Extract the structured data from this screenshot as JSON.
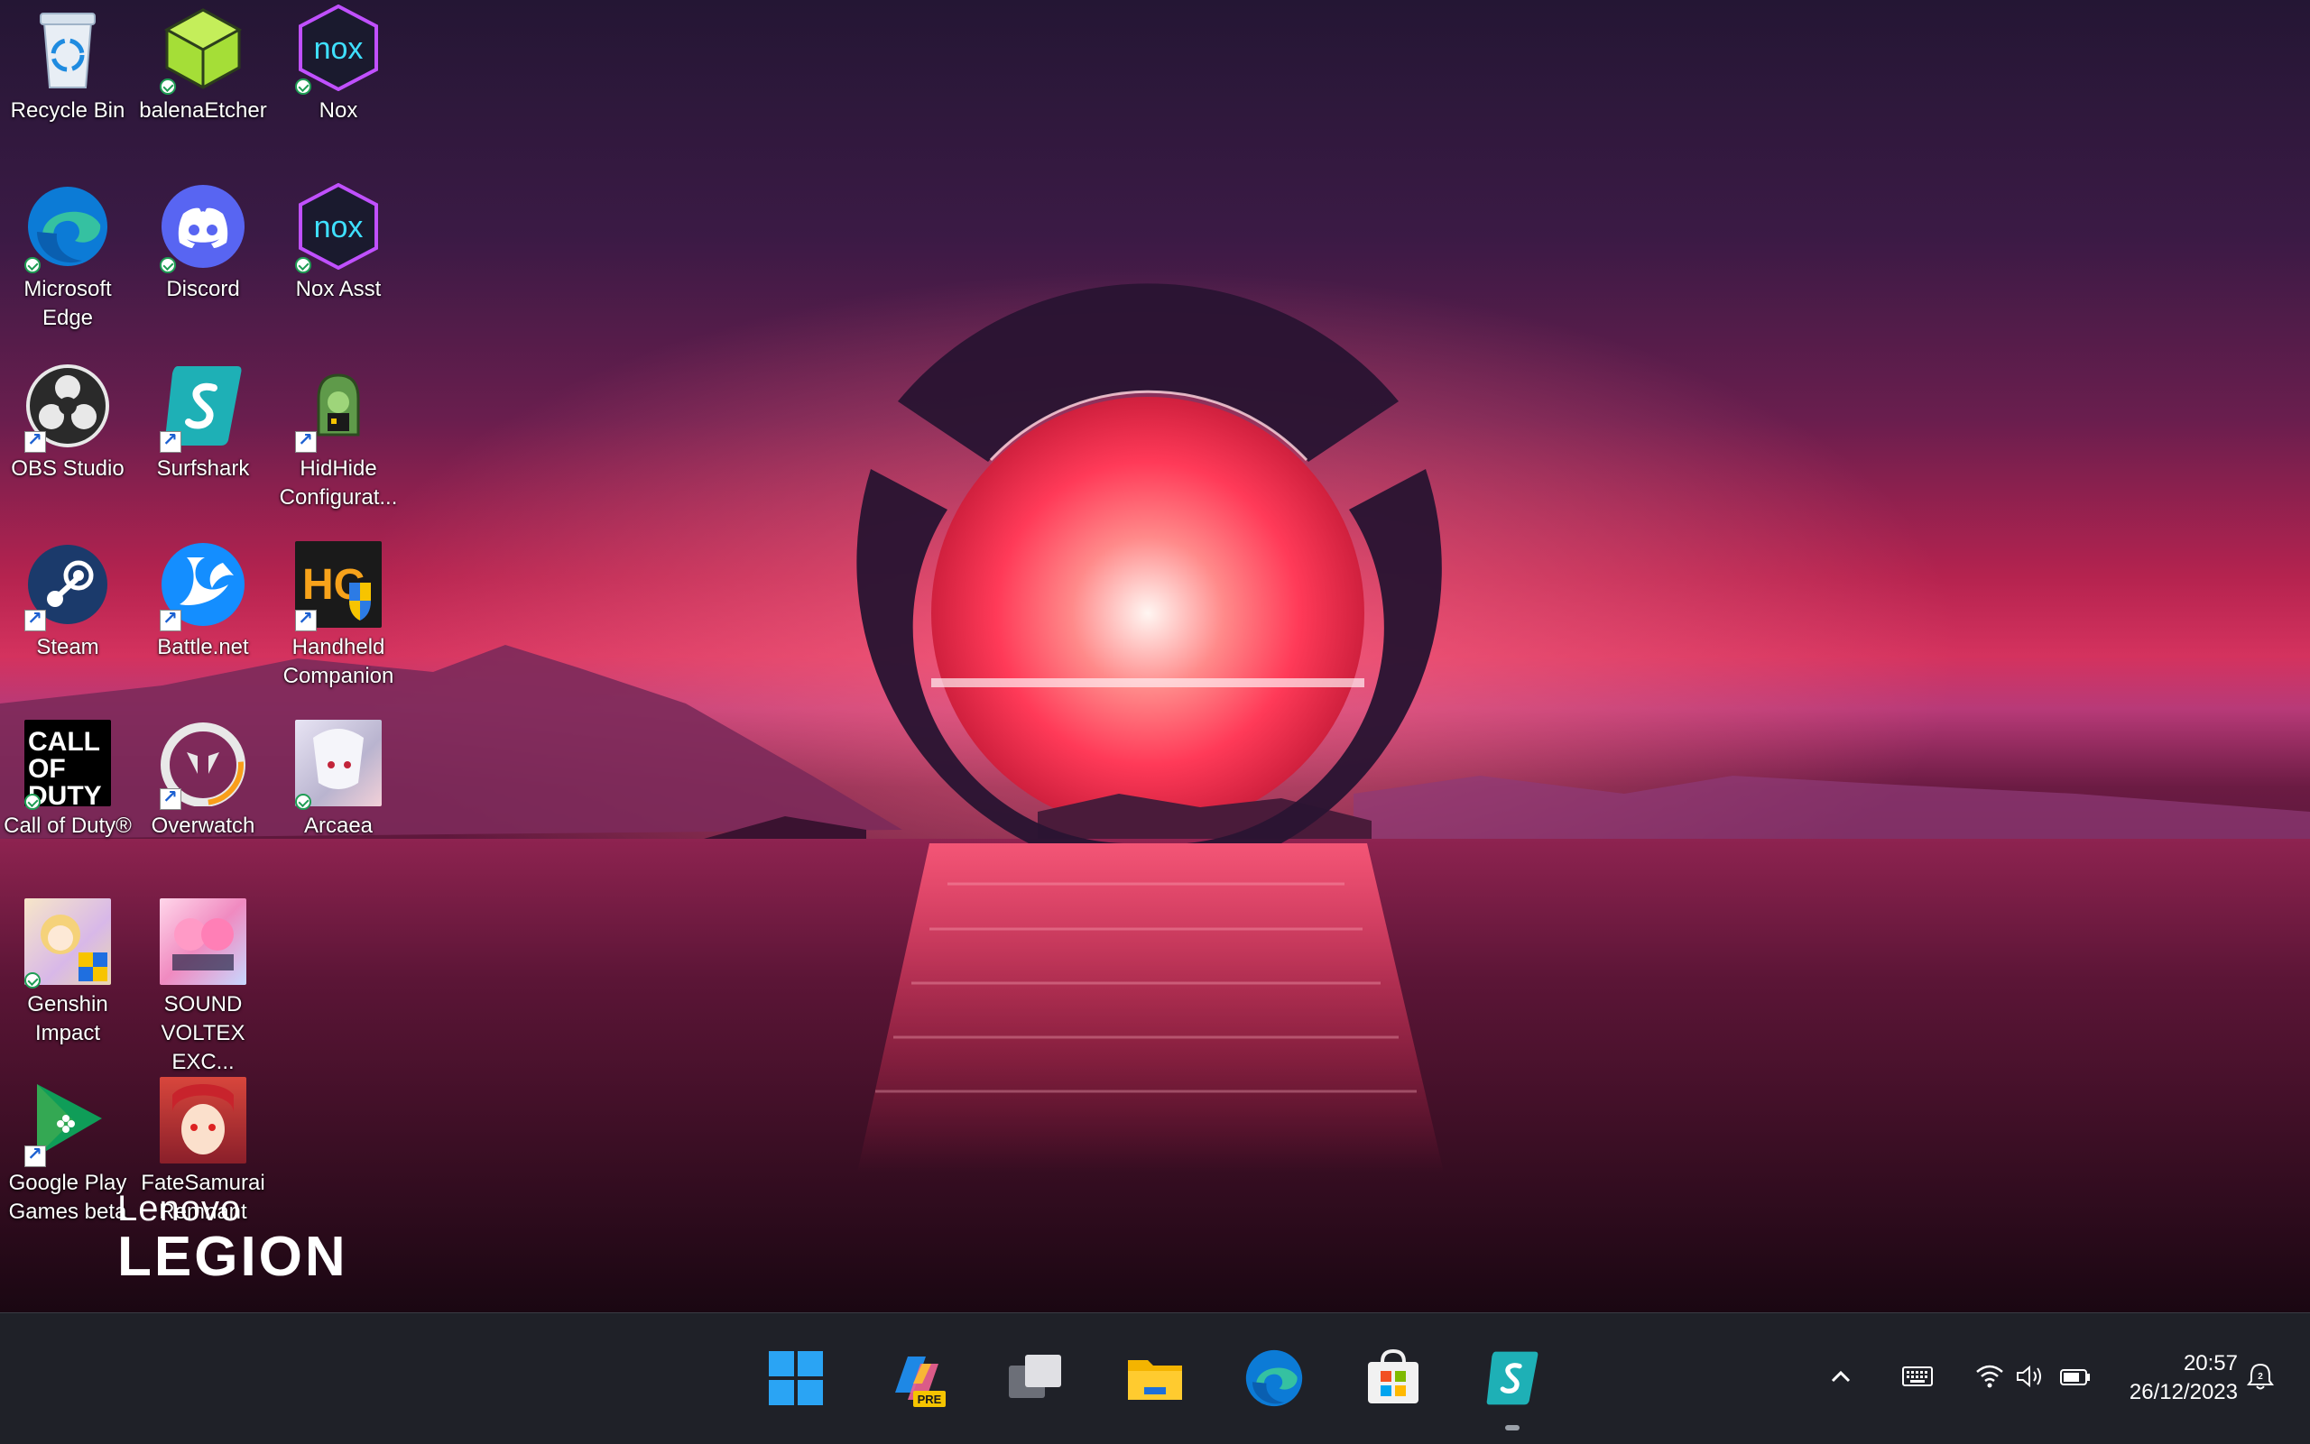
{
  "desktop": {
    "icons": [
      {
        "label": "Recycle Bin",
        "icon": "recycle-bin-icon"
      },
      {
        "label": "balenaEtcher",
        "icon": "balena-etcher-icon"
      },
      {
        "label": "Nox",
        "icon": "nox-icon"
      },
      {
        "label": "Microsoft Edge",
        "icon": "edge-icon"
      },
      {
        "label": "Discord",
        "icon": "discord-icon"
      },
      {
        "label": "Nox Asst",
        "icon": "nox-asst-icon"
      },
      {
        "label": "OBS Studio",
        "icon": "obs-icon"
      },
      {
        "label": "Surfshark",
        "icon": "surfshark-icon"
      },
      {
        "label": "HidHide Configurat...",
        "icon": "hidhide-icon"
      },
      {
        "label": "Steam",
        "icon": "steam-icon"
      },
      {
        "label": "Battle.net",
        "icon": "battlenet-icon"
      },
      {
        "label": "Handheld Companion",
        "icon": "handheld-companion-icon"
      },
      {
        "label": "Call of Duty®",
        "icon": "call-of-duty-icon",
        "art_text": "CALL OF DUTY"
      },
      {
        "label": "Overwatch",
        "icon": "overwatch-icon"
      },
      {
        "label": "Arcaea",
        "icon": "arcaea-icon"
      },
      {
        "label": "Genshin Impact",
        "icon": "genshin-icon"
      },
      {
        "label": "SOUND VOLTEX EXC...",
        "icon": "sound-voltex-icon"
      },
      {
        "label": "Google Play Games beta",
        "icon": "google-play-games-icon"
      },
      {
        "label": "FateSamurai Remnant",
        "icon": "fate-samurai-icon"
      }
    ],
    "brand": {
      "line1": "Lenovo",
      "line2": "LEGION"
    },
    "nox_logo_text": "nox",
    "handheld_logo_text": "HC"
  },
  "taskbar": {
    "apps": [
      {
        "name": "start-button",
        "icon": "windows-icon"
      },
      {
        "name": "copilot-button",
        "icon": "copilot-icon",
        "badge": "PRE"
      },
      {
        "name": "task-view-button",
        "icon": "task-view-icon"
      },
      {
        "name": "file-explorer-button",
        "icon": "folder-icon"
      },
      {
        "name": "edge-taskbar-button",
        "icon": "edge-icon"
      },
      {
        "name": "store-button",
        "icon": "store-icon"
      },
      {
        "name": "surfshark-taskbar-button",
        "icon": "surfshark-icon",
        "active": true
      }
    ],
    "tray": {
      "overflow": "chevron-up-icon",
      "keyboard": "keyboard-icon",
      "wifi": "wifi-icon",
      "volume": "volume-icon",
      "battery": "battery-icon",
      "notification": "notification-bell-icon",
      "notification_count": "2"
    },
    "clock": {
      "time": "20:57",
      "date": "26/12/2023"
    }
  },
  "colors": {
    "taskbar": "#1f2128",
    "accent": "#0078d4"
  }
}
